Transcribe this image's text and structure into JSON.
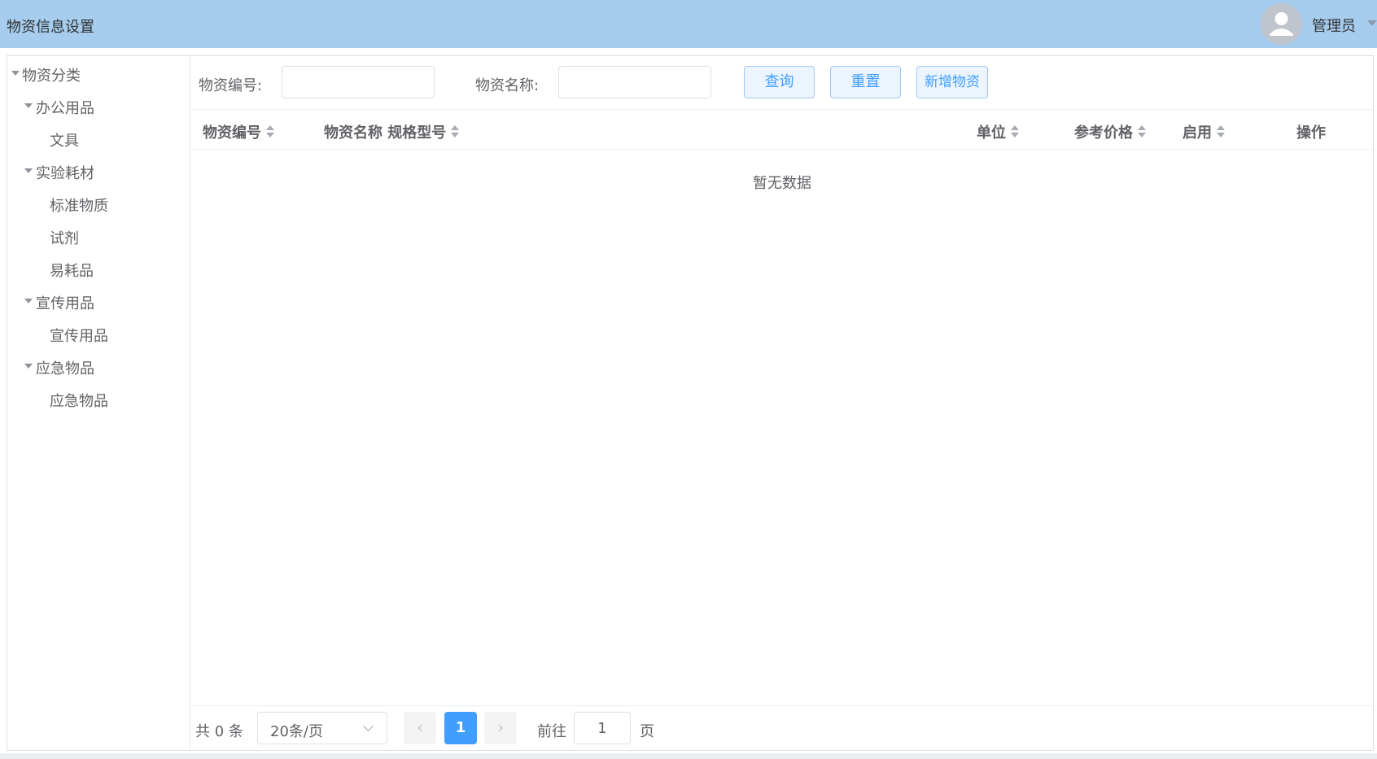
{
  "header": {
    "title": "物资信息设置",
    "user_name": "管理员"
  },
  "sidebar": {
    "tree": [
      {
        "label": "物资分类",
        "level": 0,
        "expanded": true
      },
      {
        "label": "办公用品",
        "level": 1,
        "expanded": true
      },
      {
        "label": "文具",
        "level": 2
      },
      {
        "label": "实验耗材",
        "level": 1,
        "expanded": true
      },
      {
        "label": "标准物质",
        "level": 2
      },
      {
        "label": "试剂",
        "level": 2
      },
      {
        "label": "易耗品",
        "level": 2
      },
      {
        "label": "宣传用品",
        "level": 1,
        "expanded": true
      },
      {
        "label": "宣传用品",
        "level": 2
      },
      {
        "label": "应急物品",
        "level": 1,
        "expanded": true
      },
      {
        "label": "应急物品",
        "level": 2
      }
    ]
  },
  "search": {
    "code_label": "物资编号:",
    "code_value": "",
    "name_label": "物资名称:",
    "name_value": "",
    "query_button": "查询",
    "reset_button": "重置",
    "add_button": "新增物资"
  },
  "table": {
    "columns": [
      {
        "label": "物资编号",
        "sortable": true
      },
      {
        "label": "物资名称 规格型号",
        "sortable": true
      },
      {
        "label": "单位",
        "sortable": true
      },
      {
        "label": "参考价格",
        "sortable": true
      },
      {
        "label": "启用",
        "sortable": true
      },
      {
        "label": "操作",
        "sortable": false
      }
    ],
    "rows": [],
    "empty_text": "暂无数据"
  },
  "pagination": {
    "total_text": "共 0 条",
    "page_size": "20条/页",
    "current_page": "1",
    "goto_prefix": "前往",
    "goto_value": "1",
    "goto_suffix": "页",
    "prev_icon": "‹",
    "next_icon": "›"
  }
}
